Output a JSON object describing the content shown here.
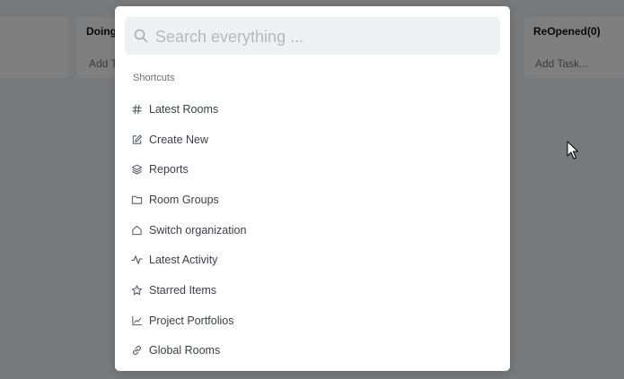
{
  "board": {
    "columns": [
      {
        "title": "Doing",
        "add_label": "Add Task..."
      },
      {
        "title": "ReOpened(0)",
        "add_label": "Add Task..."
      }
    ]
  },
  "command_palette": {
    "search_placeholder": "Search everything ...",
    "section_label": "Shortcuts",
    "items": [
      {
        "label": "Latest Rooms",
        "icon": "hash-icon"
      },
      {
        "label": "Create New",
        "icon": "edit-icon"
      },
      {
        "label": "Reports",
        "icon": "layers-icon"
      },
      {
        "label": "Room Groups",
        "icon": "folder-icon"
      },
      {
        "label": "Switch organization",
        "icon": "home-icon"
      },
      {
        "label": "Latest Activity",
        "icon": "activity-icon"
      },
      {
        "label": "Starred Items",
        "icon": "star-icon"
      },
      {
        "label": "Project Portfolios",
        "icon": "line-chart-icon"
      },
      {
        "label": "Global Rooms",
        "icon": "link-icon"
      }
    ]
  }
}
